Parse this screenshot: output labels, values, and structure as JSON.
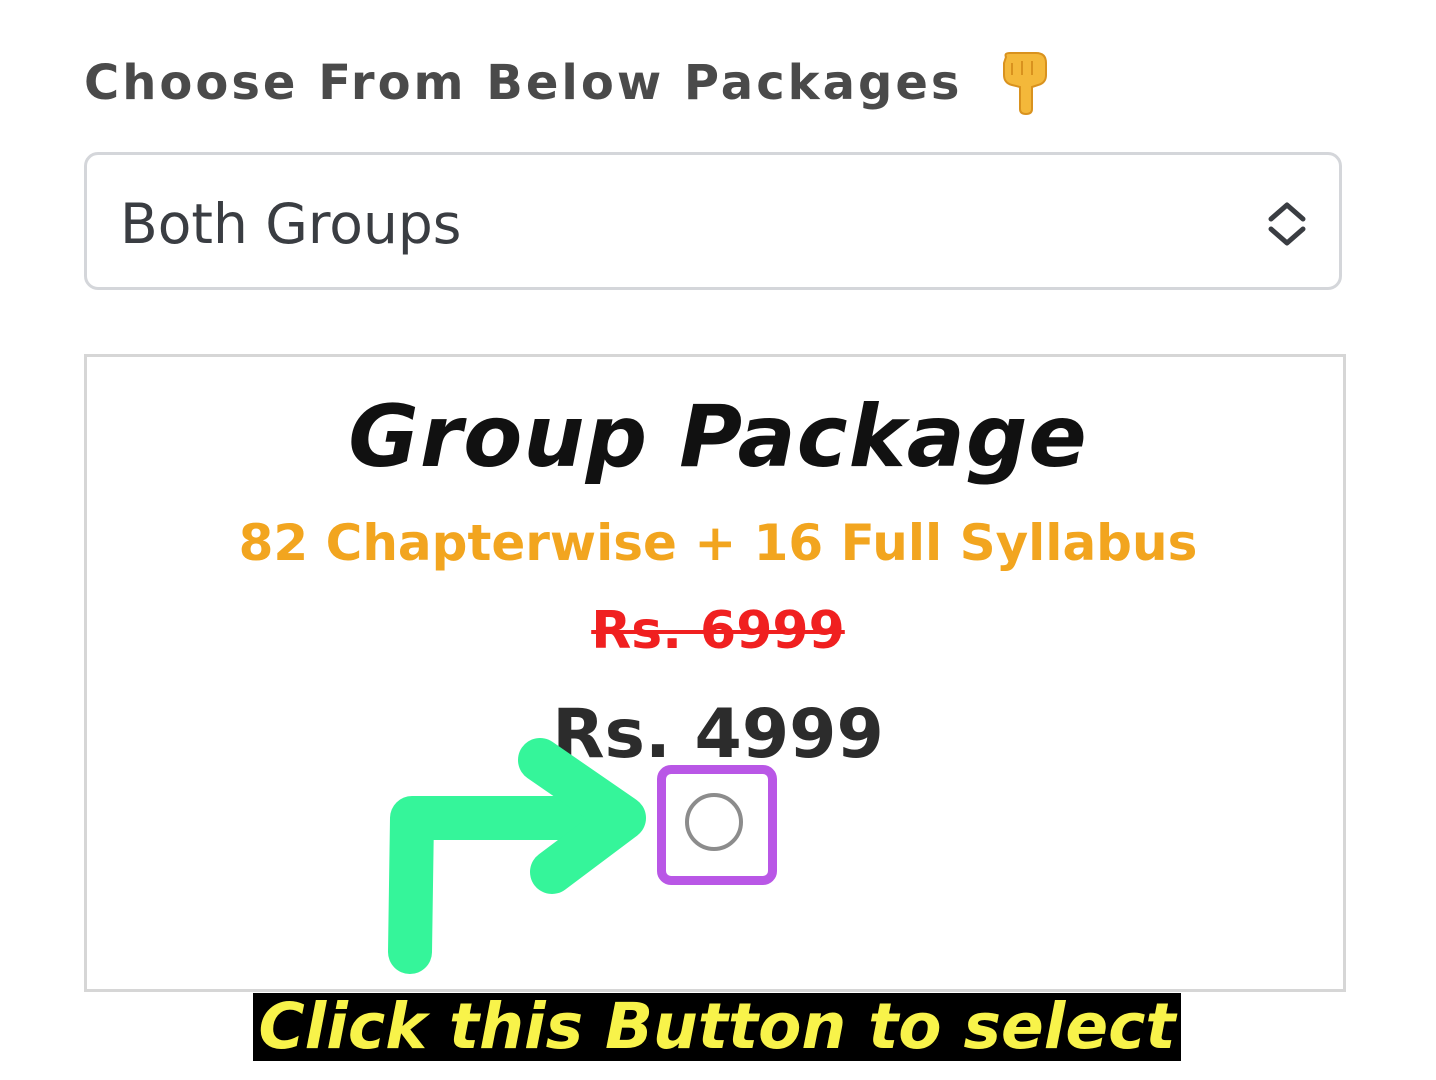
{
  "header": {
    "title": "Choose From Below Packages",
    "emoji_icon": "pointing-down-hand-icon"
  },
  "package_select": {
    "selected_value": "Both Groups",
    "chevron_icon": "up-down-chevron-icon"
  },
  "package_card": {
    "title": "Group Package",
    "subtitle": "82 Chapterwise + 16 Full Syllabus",
    "original_price": "Rs. 6999",
    "price": "Rs. 4999",
    "radio_selected": false
  },
  "annotation": {
    "caption": "Click this Button to select",
    "arrow_color": "#35f59a",
    "highlight_color": "#b957e6",
    "caption_text_color": "#f8f34a"
  },
  "colors": {
    "subtitle": "#f2a51f",
    "old_price": "#f02020",
    "heading": "#4a4a4a"
  }
}
